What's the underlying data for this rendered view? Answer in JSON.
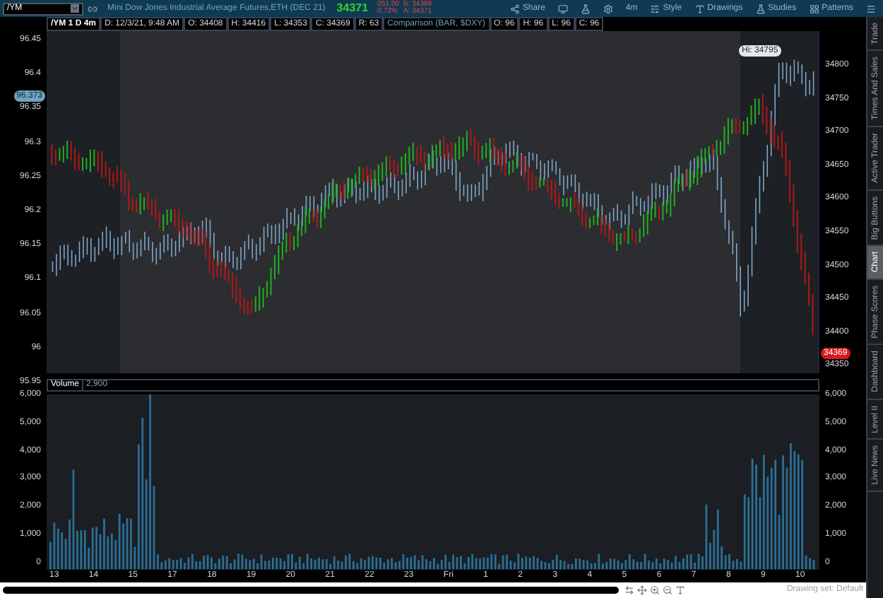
{
  "toolbar": {
    "symbol": "/YM",
    "description": "Mini Dow Jones Industrial Average Futures,ETH (DEC 21)",
    "last": "34371",
    "change": "-251.00",
    "change_pct": "-0.72%",
    "bid": "B: 34369",
    "ask": "A: 34371",
    "buttons": [
      {
        "kind": "share",
        "label": "Share"
      },
      {
        "kind": "screen"
      },
      {
        "kind": "flask"
      },
      {
        "kind": "gear"
      },
      {
        "kind": "text",
        "label": "4m"
      },
      {
        "kind": "style",
        "label": "Style"
      },
      {
        "kind": "drawings",
        "label": "Drawings"
      },
      {
        "kind": "studies",
        "label": "Studies"
      },
      {
        "kind": "patterns",
        "label": "Patterns"
      },
      {
        "kind": "menu"
      }
    ]
  },
  "header": {
    "title": "/YM 1 D 4m",
    "fields": [
      "D: 12/3/21, 9:48 AM",
      "O: 34408",
      "H: 34416",
      "L: 34353",
      "C: 34369",
      "R: 63",
      "Comparison (BAR, $DXY)",
      "O: 96",
      "H: 96",
      "L: 96",
      "C: 96"
    ]
  },
  "price_chart": {
    "left_ticks": [
      "96.45",
      "96.4",
      "96.35",
      "96.3",
      "96.25",
      "96.2",
      "96.15",
      "96.1",
      "96.05",
      "96",
      "95.95"
    ],
    "left_badge": "96.373",
    "right_ticks": [
      "34800",
      "34750",
      "34700",
      "34650",
      "34600",
      "34550",
      "34500",
      "34450",
      "34400",
      "34350"
    ],
    "right_badge": "34369",
    "tooltip": "Hi: 34795"
  },
  "volume": {
    "title": "Volume",
    "value": "2,900",
    "left_ticks": [
      "6,000",
      "5,000",
      "4,000",
      "3,000",
      "2,000",
      "1,000",
      "0"
    ],
    "right_ticks": [
      "6,000",
      "5,000",
      "4,000",
      "3,000",
      "2,000",
      "1,000",
      "0"
    ]
  },
  "x_labels": [
    "13",
    "14",
    "15",
    "17",
    "18",
    "19",
    "20",
    "21",
    "22",
    "23",
    "Fri",
    "1",
    "2",
    "3",
    "4",
    "5",
    "6",
    "7",
    "8",
    "9",
    "10"
  ],
  "status": "Drawing set: Default",
  "side_tabs": [
    {
      "label": "Trade",
      "selected": false
    },
    {
      "label": "Times And Sales",
      "selected": false
    },
    {
      "label": "Active Trader",
      "selected": false
    },
    {
      "label": "Big Buttons",
      "selected": false
    },
    {
      "label": "Chart",
      "selected": true
    },
    {
      "label": "Phase Scores",
      "selected": false
    },
    {
      "label": "Dashboard",
      "selected": false
    },
    {
      "label": "Level II",
      "selected": false
    },
    {
      "label": "Live News",
      "selected": false
    }
  ]
}
